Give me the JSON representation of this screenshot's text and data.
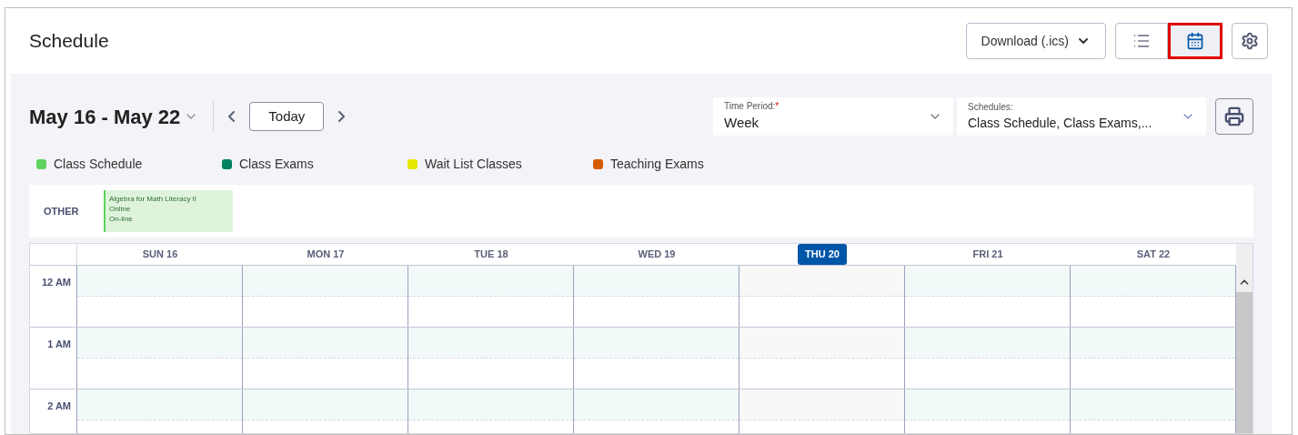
{
  "header": {
    "title": "Schedule",
    "download_button": "Download (.ics)",
    "view_buttons": [
      {
        "kind": "list",
        "selected": false
      },
      {
        "kind": "calendar",
        "selected": true
      }
    ]
  },
  "toolbar": {
    "date_range": "May 16 - May 22",
    "today_button": "Today",
    "time_period": {
      "label": "Time Period:",
      "required_mark": "*",
      "value": "Week"
    },
    "schedules": {
      "label": "Schedules:",
      "value": "Class Schedule, Class Exams,..."
    }
  },
  "legend": [
    {
      "label": "Class Schedule",
      "color": "#5fd35f"
    },
    {
      "label": "Class Exams",
      "color": "#00845f"
    },
    {
      "label": "Wait List Classes",
      "color": "#e6e600"
    },
    {
      "label": "Teaching Exams",
      "color": "#d65a00"
    }
  ],
  "other_row": {
    "label": "OTHER",
    "events": [
      {
        "lines": [
          "Algebra for Math Literacy II",
          "Online",
          "On-line"
        ]
      }
    ]
  },
  "days": [
    {
      "label": "SUN 16",
      "selected": false
    },
    {
      "label": "MON 17",
      "selected": false
    },
    {
      "label": "TUE 18",
      "selected": false
    },
    {
      "label": "WED 19",
      "selected": false
    },
    {
      "label": "THU 20",
      "selected": true
    },
    {
      "label": "FRI 21",
      "selected": false
    },
    {
      "label": "SAT 22",
      "selected": false
    }
  ],
  "hours": [
    "12 AM",
    "1 AM",
    "2 AM"
  ]
}
